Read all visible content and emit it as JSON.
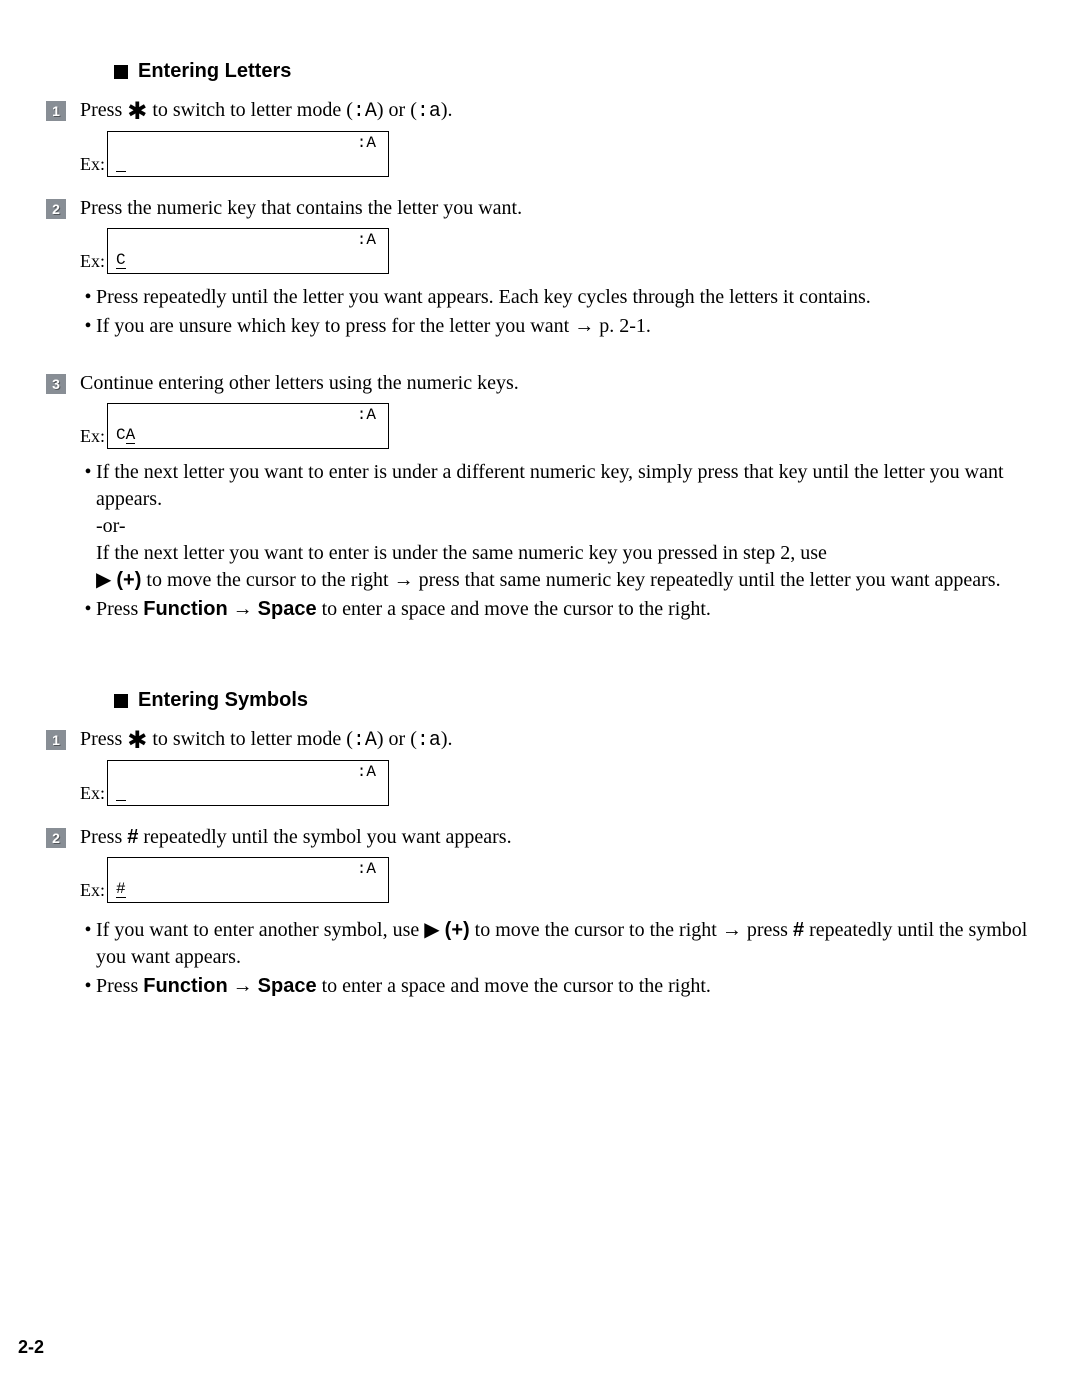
{
  "sections": {
    "letters": {
      "title": "Entering Letters",
      "steps": {
        "s1": {
          "num": "1",
          "text_pre": "Press ",
          "text_post": " to switch to letter mode (",
          "mode_upper": ":A",
          "or": ") or (",
          "mode_lower": ":a",
          "end": ").",
          "ex_label": "Ex:",
          "disp_mode": ":A",
          "disp_content": ""
        },
        "s2": {
          "num": "2",
          "text": "Press the numeric key that contains the letter you want.",
          "ex_label": "Ex:",
          "disp_mode": ":A",
          "disp_content": "C",
          "notes": {
            "n1": "Press repeatedly until the letter you want appears. Each key cycles through the letters it contains.",
            "n2_pre": "If you are unsure which key to press for the letter you want ",
            "n2_post": " p. 2-1."
          }
        },
        "s3": {
          "num": "3",
          "text": "Continue entering other letters using the numeric keys.",
          "ex_label": "Ex:",
          "disp_mode": ":A",
          "disp_content_fixed": "C",
          "disp_content_cursor": "A",
          "notes": {
            "n1_a": "If the next letter you want to enter is under a different numeric key, simply press that key until the letter you want appears.",
            "n1_or": "-or-",
            "n1_b": "If the next letter you want to enter is under the same numeric key you pressed in step 2, use",
            "n1_c_pre": " ",
            "n1_c_plus": "(+)",
            "n1_c_mid": " to move the cursor to the right ",
            "n1_c_post": " press that same numeric key repeatedly until the letter you want appears.",
            "n2_pre": "Press ",
            "n2_func": "Function",
            "n2_arrow": " ",
            "n2_space": "Space",
            "n2_post": " to enter a space and move the cursor to the right."
          }
        }
      }
    },
    "symbols": {
      "title": "Entering Symbols",
      "steps": {
        "s1": {
          "num": "1",
          "text_pre": "Press ",
          "text_post": " to switch to letter mode (",
          "mode_upper": ":A",
          "or": ") or (",
          "mode_lower": ":a",
          "end": ").",
          "ex_label": "Ex:",
          "disp_mode": ":A",
          "disp_content": ""
        },
        "s2": {
          "num": "2",
          "text_pre": "Press ",
          "hash": "#",
          "text_post": " repeatedly until the symbol you want appears.",
          "ex_label": "Ex:",
          "disp_mode": ":A",
          "disp_content": "#",
          "notes": {
            "n1_pre": "If you want to enter another symbol, use ",
            "n1_plus": "(+)",
            "n1_mid": " to move the cursor to the right ",
            "n1_mid2": " press ",
            "n1_hash": "#",
            "n1_post": " repeatedly until the symbol you want appears.",
            "n2_pre": "Press ",
            "n2_func": "Function",
            "n2_space": "Space",
            "n2_post": " to enter a space and move the cursor to the right."
          }
        }
      }
    }
  },
  "glyphs": {
    "star": "✱",
    "right_arrow": "→",
    "triangle": "▶"
  },
  "page_number": "2-2"
}
